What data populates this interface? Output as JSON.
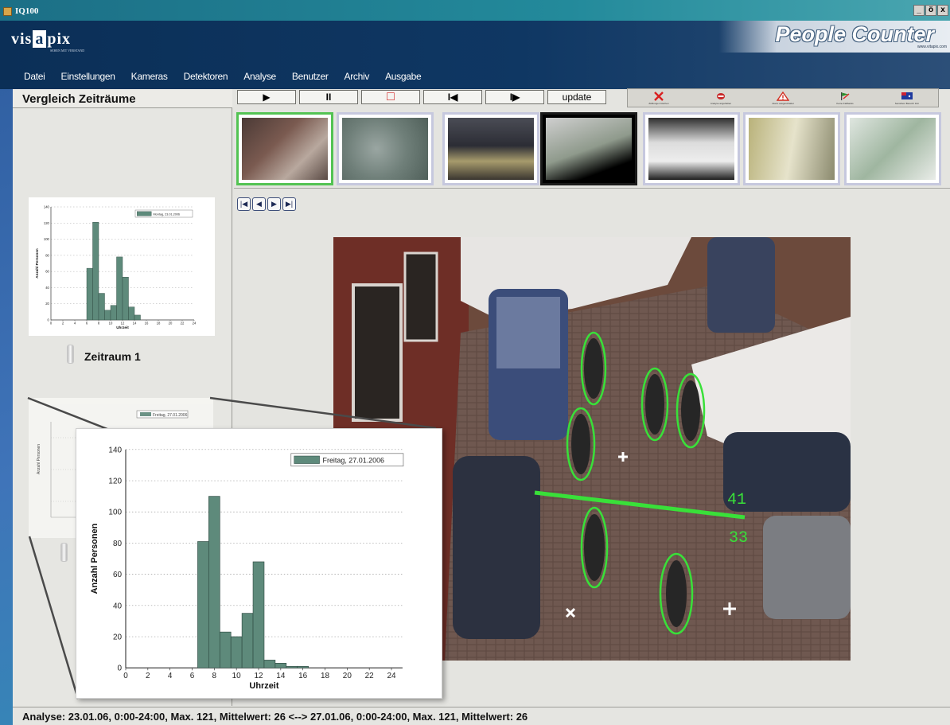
{
  "window": {
    "app_title": "IQ100",
    "minimize": "_",
    "restore": "ö",
    "close": "x"
  },
  "branding": {
    "logo_prefix": "vis",
    "logo_highlight": "a",
    "logo_suffix": "pix",
    "logo_tagline": "SEHEN MIT VERSTAND",
    "product_name": "People Counter",
    "product_url": "www.vitapix.com"
  },
  "menu": [
    "Datei",
    "Einstellungen",
    "Kameras",
    "Detektoren",
    "Analyse",
    "Benutzer",
    "Archiv",
    "Ausgabe"
  ],
  "left_panel": {
    "title": "Vergleich Zeiträume",
    "period1_label": "Zeitraum 1"
  },
  "controls": {
    "play": "▶",
    "pause": "II",
    "stop": "□",
    "prev": "I◀",
    "next": "I▶",
    "update": "update"
  },
  "toolbar": [
    {
      "icon": "x-icon",
      "label": "Zählungen löschen",
      "color": "#d92020"
    },
    {
      "icon": "stop-sign-icon",
      "label": "Analyse angehalten",
      "color": "#c82828"
    },
    {
      "icon": "warning-icon",
      "label": "Alarm ausgeschaltet",
      "color": "#d22d20"
    },
    {
      "icon": "flag-icon",
      "label": "Keine Fallbacks",
      "color": "#2c8f2c"
    },
    {
      "icon": "flag-australia-icon",
      "label": "Sensitiver Bereich Inkl.",
      "color": "#1f3a9e"
    }
  ],
  "navigation": {
    "first": "|◀",
    "prev": "◀",
    "next": "▶",
    "last": "▶|"
  },
  "camera_overlay": {
    "count_in": "41",
    "count_out": "33"
  },
  "status": {
    "text": "Analyse: 23.01.06, 0:00-24:00, Max. 121, Mittelwert: 26   <--> 27.01.06, 0:00-24:00, Max. 121, Mittelwert: 26"
  },
  "chart_data": [
    {
      "type": "bar",
      "legend": "Montag, 23.01.2006",
      "ylabel": "Anzahl Personen",
      "xlabel": "Uhrzeit",
      "x": [
        6.5,
        7.5,
        8.5,
        9.5,
        10.5,
        11.5,
        12.5,
        13.5,
        14.5
      ],
      "values": [
        64,
        121,
        33,
        12,
        18,
        78,
        53,
        16,
        6
      ],
      "xlim": [
        0,
        24
      ],
      "ylim": [
        0,
        140
      ],
      "xticks": [
        0,
        2,
        4,
        6,
        8,
        10,
        12,
        14,
        16,
        18,
        20,
        22,
        24
      ],
      "yticks": [
        0,
        20,
        40,
        60,
        80,
        100,
        120,
        140
      ],
      "grid": true,
      "legend_position": "top-right"
    },
    {
      "type": "bar",
      "legend": "Freitag, 27.01.2006",
      "ylabel": "Anzahl Personen",
      "xlabel": "Uhrzeit",
      "x": [
        7,
        8,
        9,
        10,
        11,
        12,
        13,
        14,
        15,
        16
      ],
      "values": [
        81,
        110,
        23,
        20,
        35,
        68,
        5,
        3,
        1,
        1
      ],
      "xlim": [
        0,
        25
      ],
      "ylim": [
        0,
        140
      ],
      "xticks": [
        0,
        2,
        4,
        6,
        8,
        10,
        12,
        14,
        16,
        18,
        20,
        22,
        24
      ],
      "yticks": [
        0,
        20,
        40,
        60,
        80,
        100,
        120,
        140
      ],
      "grid": true,
      "legend_position": "top-right"
    }
  ],
  "ghost_chart": {
    "legend": "Freitag, 27.01.2006",
    "ylabel": "Anzahl Personen"
  }
}
